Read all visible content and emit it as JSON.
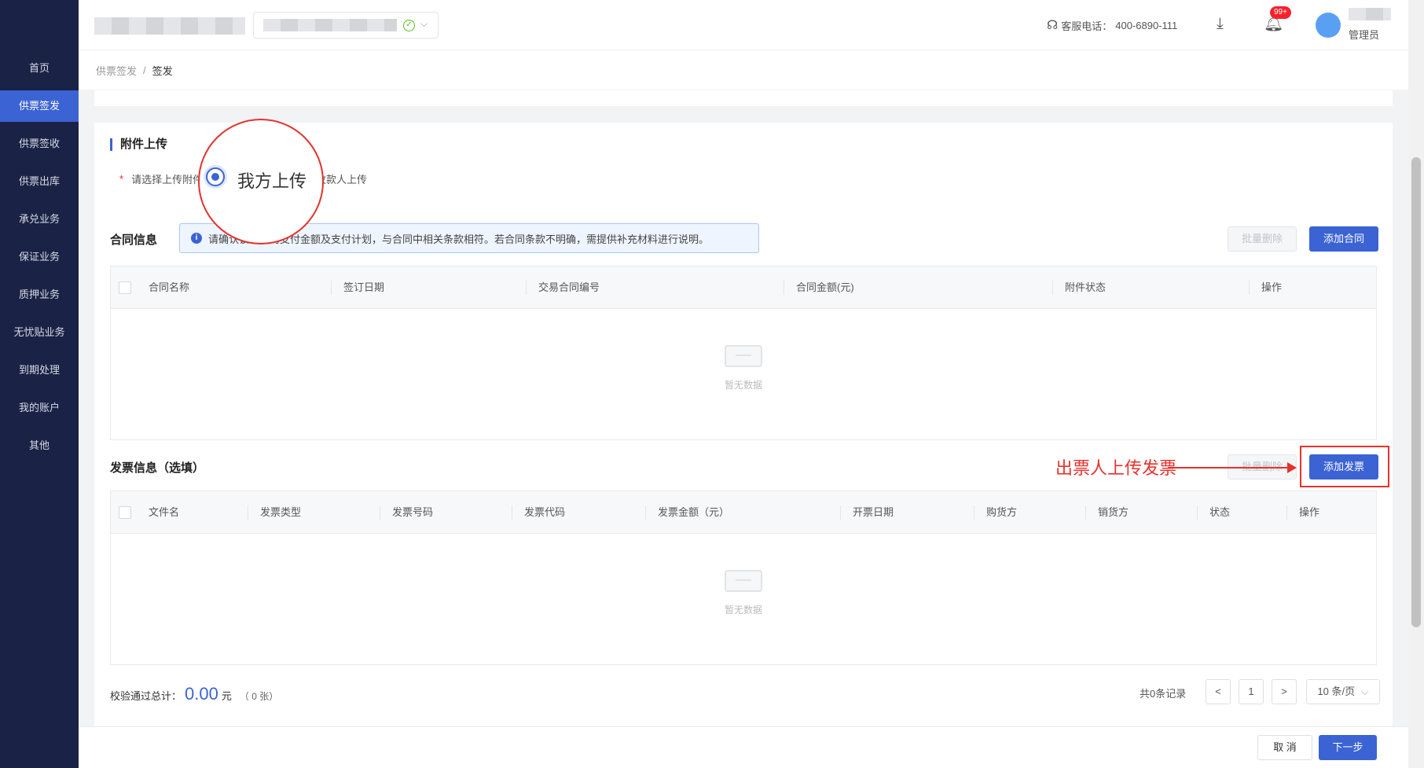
{
  "sidebar": {
    "items": [
      {
        "label": "首页",
        "active": false
      },
      {
        "label": "供票签发",
        "active": true
      },
      {
        "label": "供票签收",
        "active": false
      },
      {
        "label": "供票出库",
        "active": false
      },
      {
        "label": "承兑业务",
        "active": false
      },
      {
        "label": "保证业务",
        "active": false
      },
      {
        "label": "质押业务",
        "active": false
      },
      {
        "label": "无忧贴业务",
        "active": false
      },
      {
        "label": "到期处理",
        "active": false
      },
      {
        "label": "我的账户",
        "active": false
      },
      {
        "label": "其他",
        "active": false
      }
    ]
  },
  "header": {
    "hotline_label": "客服电话：",
    "hotline_number": "400-6890-111",
    "notification_count": "99+",
    "user_role": "管理员"
  },
  "breadcrumb": {
    "parent": "供票签发",
    "separator": "/",
    "current": "签发"
  },
  "attachment": {
    "title": "附件上传",
    "required_mark": "*",
    "question": "请选择上传附件",
    "option_self": "我方上传",
    "option_payee": "收款人上传"
  },
  "contract": {
    "title": "合同信息",
    "notice": "请确认该合同的支付金额及支付计划，与合同中相关条款相符。若合同条款不明确，需提供补充材料进行说明。",
    "batch_delete": "批量删除",
    "add": "添加合同",
    "columns": [
      "合同名称",
      "签订日期",
      "交易合同编号",
      "合同金额(元)",
      "附件状态",
      "操作"
    ],
    "empty_text": "暂无数据"
  },
  "invoice": {
    "title": "发票信息（选填）",
    "batch_delete": "批量删除",
    "add": "添加发票",
    "columns": [
      "文件名",
      "发票类型",
      "发票号码",
      "发票代码",
      "发票金额（元）",
      "开票日期",
      "购货方",
      "销货方",
      "状态",
      "操作"
    ],
    "empty_text": "暂无数据"
  },
  "summary": {
    "label": "校验通过总计：",
    "amount": "0.00",
    "unit": "元",
    "count": "（ 0 张）"
  },
  "pagination": {
    "total_text": "共0条记录",
    "prev": "<",
    "page": "1",
    "next": ">",
    "page_size": "10 条/页"
  },
  "annotation": {
    "text": "出票人上传发票",
    "accent": "#e5322d"
  },
  "footer": {
    "cancel": "取 消",
    "next": "下一步"
  },
  "colors": {
    "primary": "#3b63d3",
    "sidebar": "#1a2345"
  }
}
